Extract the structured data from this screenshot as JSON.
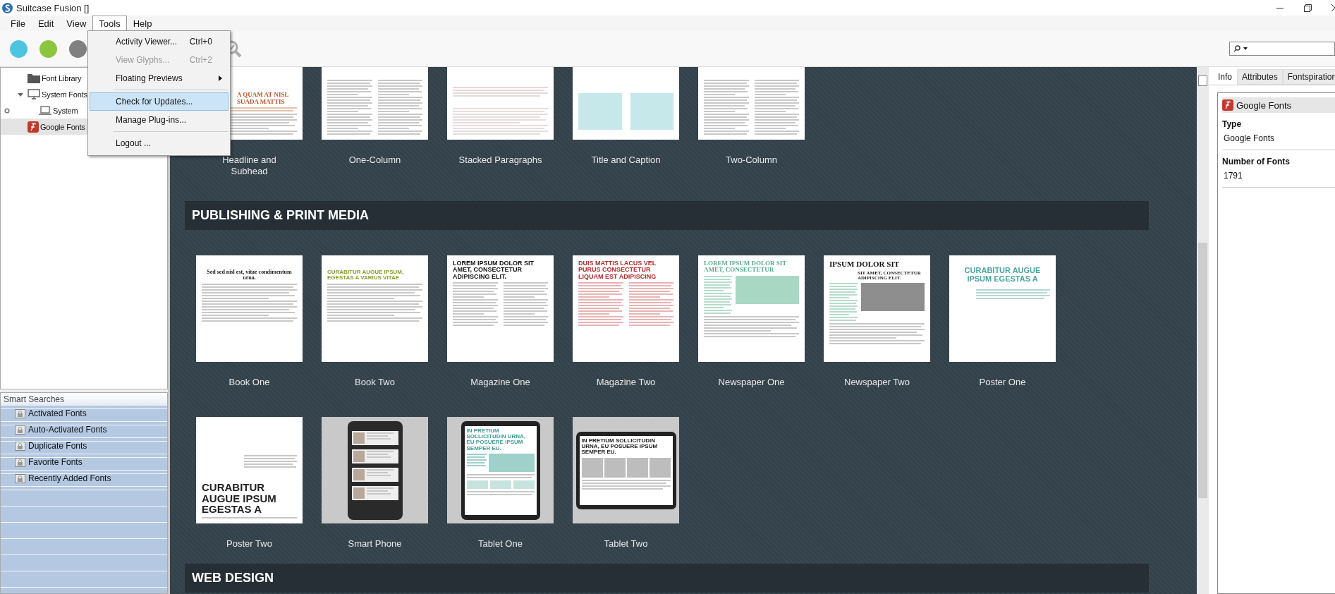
{
  "window": {
    "title": "Suitcase Fusion []"
  },
  "menu_bar": [
    {
      "label": "File",
      "selected": false
    },
    {
      "label": "Edit",
      "selected": false
    },
    {
      "label": "View",
      "selected": false
    },
    {
      "label": "Tools",
      "selected": true
    },
    {
      "label": "Help",
      "selected": false
    }
  ],
  "tools_menu": [
    {
      "kind": "item",
      "label": "Activity Viewer...",
      "shortcut": "Ctrl+0",
      "disabled": false,
      "highlighted": false,
      "submenu": false
    },
    {
      "kind": "item",
      "label": "View Glyphs...",
      "shortcut": "Ctrl+2",
      "disabled": true,
      "highlighted": false,
      "submenu": false
    },
    {
      "kind": "item",
      "label": "Floating Previews",
      "disabled": false,
      "highlighted": false,
      "submenu": true
    },
    {
      "kind": "separator"
    },
    {
      "kind": "item",
      "label": "Check for Updates...",
      "disabled": false,
      "highlighted": true,
      "submenu": false
    },
    {
      "kind": "item",
      "label": "Manage Plug-ins...",
      "disabled": false,
      "highlighted": false,
      "submenu": false
    },
    {
      "kind": "separator"
    },
    {
      "kind": "item",
      "label": "Logout ...",
      "disabled": false,
      "highlighted": false,
      "submenu": false
    }
  ],
  "toolbar": [
    {
      "color": "#4cc6e0"
    },
    {
      "color": "#8cc63f"
    },
    {
      "color": "#808080"
    }
  ],
  "library": [
    {
      "label": "Font Library",
      "kind": "folder",
      "selected": false
    },
    {
      "label": "System Fonts",
      "kind": "monitor",
      "selected": false,
      "expanded": true,
      "children": [
        {
          "label": "System",
          "kind": "laptop",
          "selected": false
        }
      ]
    },
    {
      "label": "Google Fonts",
      "kind": "google",
      "selected": true
    }
  ],
  "smart_searches": {
    "title": "Smart Searches",
    "items": [
      "Activated Fonts",
      "Auto-Activated Fonts",
      "Duplicate Fonts",
      "Favorite Fonts",
      "Recently Added Fonts"
    ]
  },
  "gallery": {
    "top_row": [
      {
        "name": "Headline and Subhead",
        "kind": "headline",
        "headline": "A QUAM AT NISL SUADA MATTIS",
        "color": "#b5532f"
      },
      {
        "name": "One-Column",
        "kind": "columns"
      },
      {
        "name": "Stacked Paragraphs",
        "kind": "paragraphs"
      },
      {
        "name": "Title and Caption",
        "kind": "caption"
      },
      {
        "name": "Two-Column",
        "kind": "columns"
      }
    ],
    "sections": [
      {
        "title": "PUBLISHING & PRINT MEDIA",
        "templates": [
          {
            "name": "Book One",
            "kind": "book",
            "headline": "Sed sed nisl est, vitae condimentum urna.",
            "color": "#222222"
          },
          {
            "name": "Book Two",
            "kind": "book",
            "headline": "CURABITUR AUGUE IPSUM, EGESTAS A VARIUS VITAE",
            "color": "#8a9a2e"
          },
          {
            "name": "Magazine One",
            "kind": "magazine",
            "headline": "LOREM IPSUM DOLOR SIT AMET, CONSECTETUR ADIPISCING ELIT.",
            "color": "#111111"
          },
          {
            "name": "Magazine Two",
            "kind": "magazine",
            "headline": "DUIS MATTIS LACUS VEL PURUS CONSECTETUR LIQUAM EST ADIPISCING",
            "color": "#b02a2a"
          },
          {
            "name": "Newspaper One",
            "kind": "newspaper",
            "headline": "LOREM IPSUM DOLOR SIT AMET, CONSECTETUR",
            "color": "#5aaa8c"
          },
          {
            "name": "Newspaper Two",
            "kind": "newspaper",
            "headline": "IPSUM DOLOR SIT",
            "subhead": "SIT AMET, CONSECTETUR ADIPISCING ELIT.",
            "color": "#111111"
          },
          {
            "name": "Poster One",
            "kind": "poster",
            "headline": "CURABITUR AUGUE IPSUM EGESTAS A",
            "color": "#4aa3a0"
          },
          {
            "name": "Poster Two",
            "kind": "poster-bottom",
            "headline": "CURABITUR AUGUE IPSUM EGESTAS A",
            "color": "#222222"
          },
          {
            "name": "Smart Phone",
            "kind": "phone"
          },
          {
            "name": "Tablet One",
            "kind": "tablet",
            "headline": "IN PRETIUM SOLLICITUDIN URNA, EU POSUERE IPSUM SEMPER EU.",
            "color": "#3f9c98"
          },
          {
            "name": "Tablet Two",
            "kind": "tablet-wide",
            "headline": "IN PRETIUM SOLLICITUDIN URNA, EU POSUERE IPSUM SEMPER EU.",
            "color": "#222222"
          }
        ]
      },
      {
        "title": "WEB DESIGN"
      }
    ]
  },
  "info_panel": {
    "tabs": [
      {
        "label": "Info",
        "selected": true
      },
      {
        "label": "Attributes",
        "selected": false
      },
      {
        "label": "Fontspiration",
        "selected": false
      }
    ],
    "source": "Google Fonts",
    "fields": [
      {
        "label": "Type",
        "value": "Google Fonts"
      },
      {
        "label": "Number of Fonts",
        "value": "1791"
      }
    ]
  }
}
